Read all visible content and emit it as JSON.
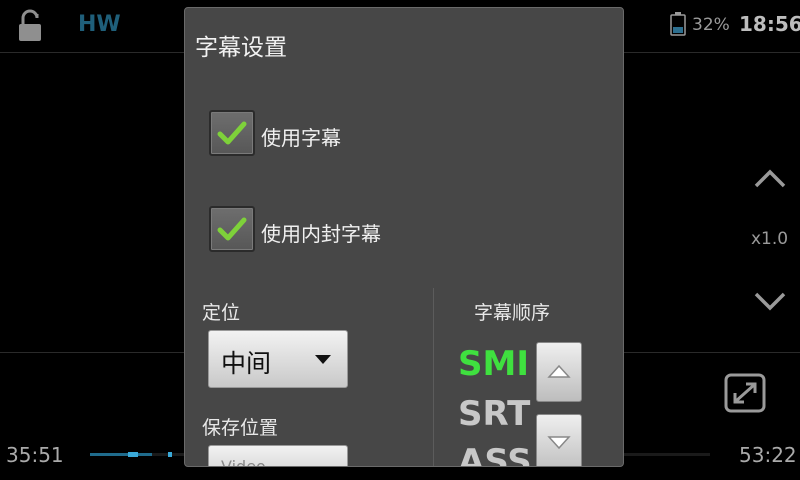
{
  "status_bar": {
    "hw_label": "HW",
    "battery_percent": "32%",
    "clock": "18:56",
    "icons": [
      "lock-icon",
      "battery-icon"
    ]
  },
  "player": {
    "speed": "x1.0",
    "time_elapsed": "35:51",
    "time_total": "53:22",
    "progress": 0.67,
    "icons": [
      "chevron-up-icon",
      "chevron-down-icon",
      "fullscreen-icon"
    ]
  },
  "dialog": {
    "title": "字幕设置",
    "use_subtitles": {
      "label": "使用字幕",
      "checked": true
    },
    "use_embedded_subtitles": {
      "label": "使用内封字幕",
      "checked": true
    },
    "position": {
      "label": "定位",
      "value": "中间"
    },
    "save_location": {
      "label": "保存位置",
      "value": "Video"
    },
    "subtitle_order": {
      "label": "字幕顺序",
      "items": [
        "SMI",
        "SRT",
        "ASS"
      ],
      "active_color": "#3fe03f",
      "inactive_color": "#c8c8c8"
    },
    "accent_check_color": "#7ed13a"
  }
}
